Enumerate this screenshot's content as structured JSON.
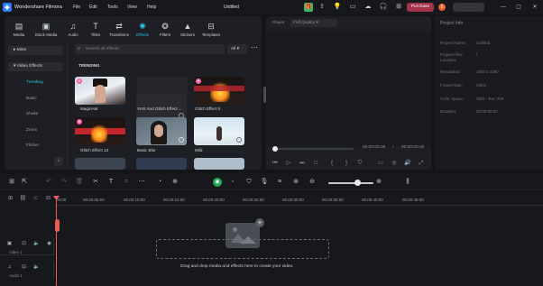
{
  "app": {
    "name": "Wondershare Filmora",
    "logo": "filmora-logo",
    "window_title": "Untitled"
  },
  "menu": [
    "File",
    "Edit",
    "Tools",
    "View",
    "Help"
  ],
  "title_actions": {
    "purchase_label": "Purchase",
    "notification_count": "8"
  },
  "library": {
    "tabs": [
      {
        "label": "Media",
        "icon": "media-icon"
      },
      {
        "label": "Stock Media",
        "icon": "stock-media-icon"
      },
      {
        "label": "Audio",
        "icon": "audio-icon"
      },
      {
        "label": "Titles",
        "icon": "titles-icon"
      },
      {
        "label": "Transitions",
        "icon": "transitions-icon"
      },
      {
        "label": "Effects",
        "icon": "effects-icon",
        "active": true
      },
      {
        "label": "Filters",
        "icon": "filters-icon"
      },
      {
        "label": "Stickers",
        "icon": "stickers-icon"
      },
      {
        "label": "Templates",
        "icon": "templates-icon"
      }
    ],
    "sidebar": {
      "categories": [
        "Mine",
        "Video Effects"
      ],
      "subcategories": [
        "Trending",
        "Basic",
        "Shake",
        "Zoom",
        "Flicker"
      ],
      "active_subcategory": "Trending"
    },
    "search_placeholder": "Search all effects",
    "filter_value": "All",
    "section_title": "TRENDING",
    "items": [
      {
        "label": "MagicHat",
        "premium": true
      },
      {
        "label": "VHS And Glitch Effect ...",
        "premium": false
      },
      {
        "label": "Glitch Effect II",
        "premium": true
      },
      {
        "label": "Glitch Effect 13",
        "premium": true
      },
      {
        "label": "Basic Blur",
        "premium": false
      },
      {
        "label": "Mild",
        "premium": false
      },
      {
        "label": "",
        "premium": false
      },
      {
        "label": "",
        "premium": false
      },
      {
        "label": "",
        "premium": false
      }
    ]
  },
  "player": {
    "label": "Player",
    "quality": "Full Quality",
    "current_time": "00:00:00:00",
    "total_time": "00:00:00:00"
  },
  "project_info": {
    "title": "Project Info",
    "fields": [
      {
        "key": "Project Name:",
        "value": "Untitled"
      },
      {
        "key": "Project Files Location:",
        "value": "/"
      },
      {
        "key": "Resolution:",
        "value": "1920 x 1080"
      },
      {
        "key": "Frame Rate:",
        "value": "25fps"
      },
      {
        "key": "Color Space:",
        "value": "SDR - Rec.709"
      },
      {
        "key": "Duration:",
        "value": "00:00:00:00"
      }
    ]
  },
  "timeline": {
    "ruler": [
      "00:00",
      "00:00:05:00",
      "00:00:10:00",
      "00:00:15:00",
      "00:00:20:00",
      "00:00:25:00",
      "00:00:30:00",
      "00:00:35:00",
      "00:00:40:00",
      "00:00:45:00"
    ],
    "tracks": [
      {
        "label": "Video 1"
      },
      {
        "label": "Audio 1"
      }
    ],
    "drop_text": "Drag and drop media and effects here to create your video."
  },
  "colors": {
    "accent": "#2ec4e6",
    "purchase": "#a3324a",
    "playhead": "#e85b5b",
    "ai_button": "#1fa855"
  }
}
